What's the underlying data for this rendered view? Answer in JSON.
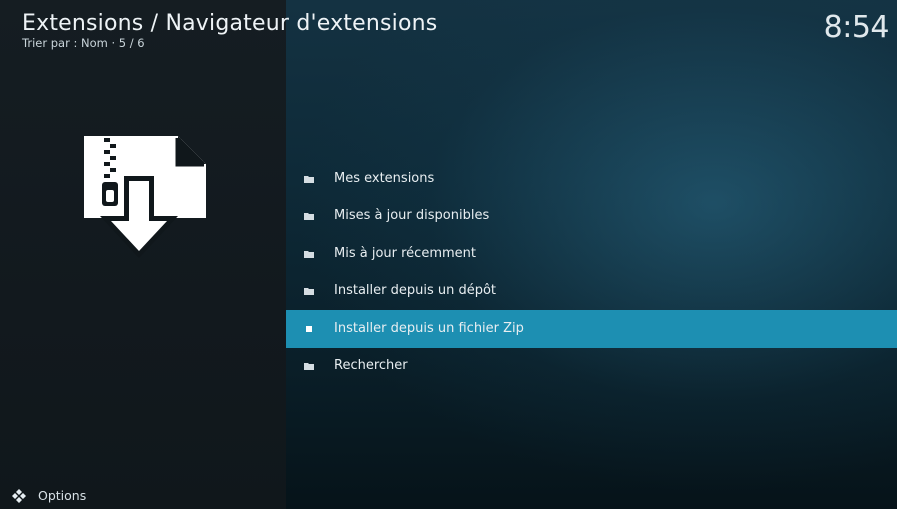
{
  "header": {
    "title": "Extensions / Navigateur d'extensions",
    "subtitle": "Trier par : Nom  ·  5 / 6"
  },
  "clock": "8:54",
  "menu": {
    "items": [
      {
        "label": "Mes extensions",
        "icon": "folder-icon"
      },
      {
        "label": "Mises à jour disponibles",
        "icon": "folder-icon"
      },
      {
        "label": "Mis à jour récemment",
        "icon": "folder-icon"
      },
      {
        "label": "Installer depuis un dépôt",
        "icon": "folder-icon"
      },
      {
        "label": "Installer depuis un fichier Zip",
        "icon": "bullet-icon",
        "selected": true
      },
      {
        "label": "Rechercher",
        "icon": "folder-icon"
      }
    ]
  },
  "footer": {
    "options_label": "Options"
  },
  "colors": {
    "selection": "#1d8fb2",
    "left_panel": "#151d22",
    "right_panel": "#123040"
  },
  "preview_icon": "zip-download-icon"
}
